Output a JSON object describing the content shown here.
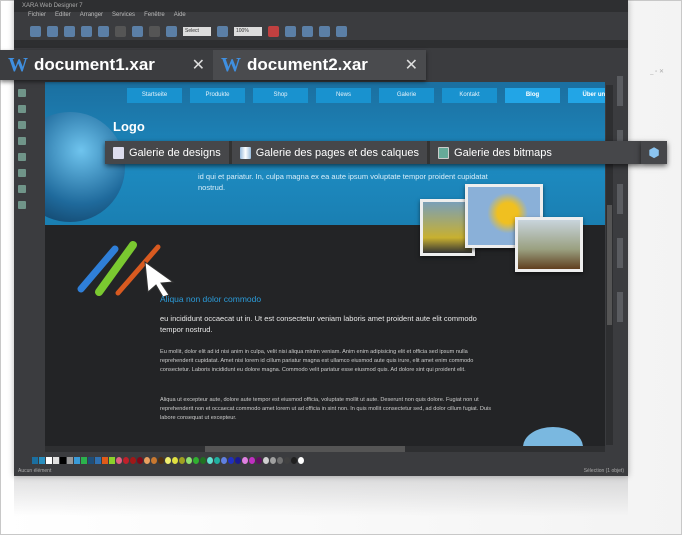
{
  "app": {
    "title": "XARA Web Designer 7",
    "menus": [
      "Fichier",
      "Editer",
      "Arranger",
      "Services",
      "Fenêtre",
      "Aide"
    ],
    "zoom": "100%",
    "select": "Select"
  },
  "tabs": [
    {
      "label": "document1.xar",
      "active": true
    },
    {
      "label": "document2.xar",
      "active": false
    }
  ],
  "page": {
    "nav": [
      "Startseite",
      "Produkte",
      "Shop",
      "News",
      "Galerie",
      "Kontakt",
      "Blog",
      "Über uns"
    ],
    "nav_active": "Blog",
    "logo": "Logo",
    "intro": "id qui et pariatur. In, culpa magna ex ea aute ipsum voluptate tempor proident cupidatat nostrud.",
    "heading": "Aliqua non dolor commodo",
    "lead": "eu incididunt occaecat ut in. Ut est consectetur veniam laboris amet proident aute elit commodo tempor nostrud.",
    "para1": "Eu mollit, dolor elit ad id nisi anim in culpa, velit nisi aliqua minim veniam. Anim enim adipisicing elit et officia sed ipsum nulla reprehenderit cupidatat. Amet nisi lorem id cillum pariatur magna est ullamco eiusmod aute quis irure, elit amet enim commodo consectetur. Laboris incididunt eu dolore magna. Commodo velit pariatur esse eiusmod quis. Ad dolore sint qui proident elit.",
    "para2": "Aliqua ut excepteur aute, dolore aute tempor est eiusmod officia, voluptate mollit ut aute. Deserunt non quis dolore. Fugiat non ut reprehenderit non et occaecat commodo amet lorem ut ad officia in sint non. In quis mollit consectetur sed, ad dolor cillum fugiat. Duis labore consequat ut excepteur."
  },
  "galleries": [
    {
      "label": "Galerie de designs",
      "icon": "document-icon"
    },
    {
      "label": "Galerie des pages et des calques",
      "icon": "pages-icon"
    },
    {
      "label": "Galerie des bitmaps",
      "icon": "bitmap-icon"
    }
  ],
  "status": {
    "left": "Aucun élément",
    "right": "Sélection (1 objet)"
  },
  "palette": [
    "#1b6fa0",
    "#2a8fbf",
    "#ffffff",
    "#e0e0e0",
    "#000000",
    "#999999",
    "#3a9bd8",
    "#2bb24c",
    "#1f4e79",
    "#3070b0",
    "#e05a1a",
    "#8bd12b",
    "#e06080",
    "#c0202a",
    "#a01818",
    "#800818",
    "#e8a060",
    "#c87830",
    "#503010",
    "#f0f070",
    "#e0e040",
    "#a0a020",
    "#90e070",
    "#30b030",
    "#207020",
    "#60e0d0",
    "#20b0a0",
    "#6080e0",
    "#2030c0",
    "#1a1a90",
    "#e080e0",
    "#c030c0",
    "#601060",
    "#d0d0d0",
    "#a0a0a0",
    "#707070",
    "#404040",
    "#202020",
    "#ffffff"
  ]
}
